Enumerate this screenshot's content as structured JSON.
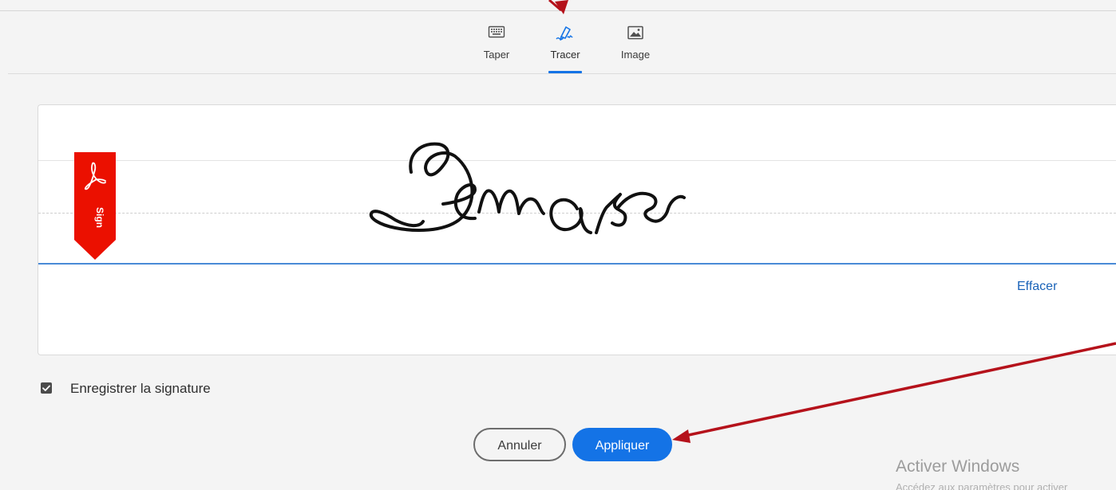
{
  "tabs": [
    {
      "label": "Taper",
      "icon": "keyboard-icon"
    },
    {
      "label": "Tracer",
      "icon": "pen-draw-icon",
      "active": true
    },
    {
      "label": "Image",
      "icon": "image-icon"
    }
  ],
  "signature_pad": {
    "clear_label": "Effacer",
    "badge": {
      "icon": "acrobat-sign-icon",
      "text": "Sign",
      "color": "#eb1000"
    },
    "drawn_text": "Demas"
  },
  "save_signature": {
    "label": "Enregistrer la signature",
    "checked": true
  },
  "buttons": {
    "cancel": "Annuler",
    "apply": "Appliquer"
  },
  "accent_color": "#1473e6",
  "annotation_color": "#b5121b",
  "os_watermark": {
    "title": "Activer Windows",
    "subtitle": "Accédez aux paramètres pour activer"
  }
}
